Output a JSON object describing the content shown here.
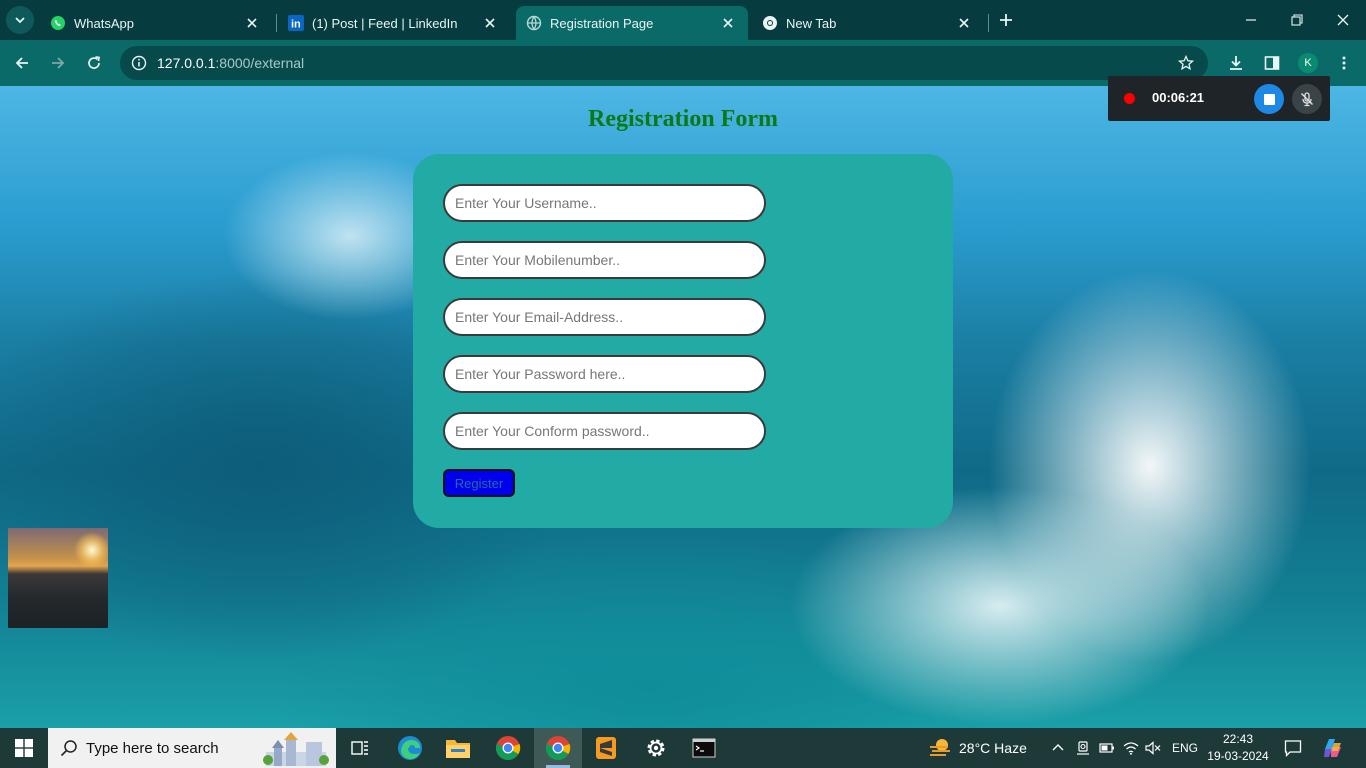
{
  "browser": {
    "tabs": [
      {
        "title": "WhatsApp",
        "icon": "whatsapp-icon"
      },
      {
        "title": "(1) Post | Feed | LinkedIn",
        "icon": "linkedin-icon"
      },
      {
        "title": "Registration Page",
        "icon": "page-loading-icon",
        "active": true
      },
      {
        "title": "New Tab",
        "icon": "chrome-icon"
      }
    ],
    "url_host": "127.0.0.1",
    "url_path": ":8000/external",
    "profile_initial": "K"
  },
  "page": {
    "title": "Registration Form",
    "fields": [
      {
        "placeholder": "Enter Your Username.."
      },
      {
        "placeholder": "Enter Your Mobilenumber.."
      },
      {
        "placeholder": "Enter Your Email-Address.."
      },
      {
        "placeholder": "Enter Your Password here.."
      },
      {
        "placeholder": "Enter Your Conform password.."
      }
    ],
    "register_label": "Register"
  },
  "recorder": {
    "time": "00:06:21"
  },
  "taskbar": {
    "search_placeholder": "Type here to search",
    "weather": "28°C  Haze",
    "language": "ENG",
    "time": "22:43",
    "date": "19-03-2024"
  },
  "colors": {
    "form_card": "#21aba4",
    "title": "#0a7a16",
    "register_button": "#0000ee",
    "browser_frame": "#0a6a68"
  }
}
